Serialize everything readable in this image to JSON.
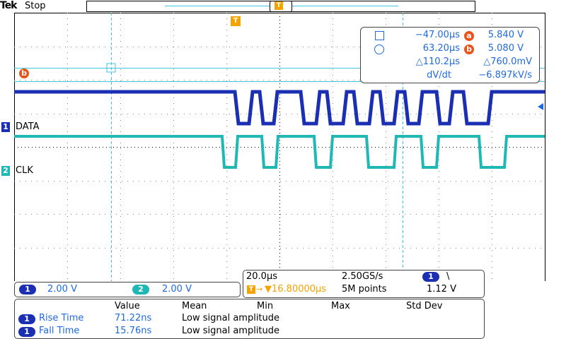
{
  "header": {
    "brand": "Tek",
    "state": "Stop"
  },
  "colors": {
    "ch1": "#1b2fb3",
    "ch2": "#1fb8b4",
    "cursor": "#41c4e0",
    "trigger": "#f5a300",
    "accent": "#1f6ae0",
    "badge": "#e8541a"
  },
  "markers": {
    "trigger_top": "T",
    "trigger_small": "T",
    "cursor_b": "b"
  },
  "channels": [
    {
      "number": "1",
      "label": "DATA"
    },
    {
      "number": "2",
      "label": "CLK"
    }
  ],
  "cursor_readout": {
    "row1": {
      "time": "−47.00µs",
      "badge": "a",
      "volt": "5.840 V"
    },
    "row2": {
      "time": "63.20µs",
      "badge": "b",
      "volt": "5.080 V"
    },
    "row3": {
      "delta_t": "△110.2µs",
      "delta_v": "△760.0mV"
    },
    "row4": {
      "label": "dV/dt",
      "value": "−6.897kV/s"
    }
  },
  "vertical": {
    "ch1": {
      "number": "1",
      "scale": "2.00 V"
    },
    "ch2": {
      "number": "2",
      "scale": "2.00 V"
    }
  },
  "horizontal": {
    "time_div": "20.0µs",
    "sample_rate": "2.50GS/s",
    "trig_source": "1",
    "trig_slope": "\\",
    "trig_pos": "▼16.80000µs",
    "record": "5M points",
    "trig_level": "1.12 V"
  },
  "measurements": {
    "headers": [
      "Value",
      "Mean",
      "Min",
      "Max",
      "Std Dev"
    ],
    "rows": [
      {
        "ch": "1",
        "name": "Rise Time",
        "value": "71.22ns",
        "mean": "Low signal amplitude"
      },
      {
        "ch": "1",
        "name": "Fall Time",
        "value": "15.76ns",
        "mean": "Low signal amplitude"
      }
    ]
  }
}
